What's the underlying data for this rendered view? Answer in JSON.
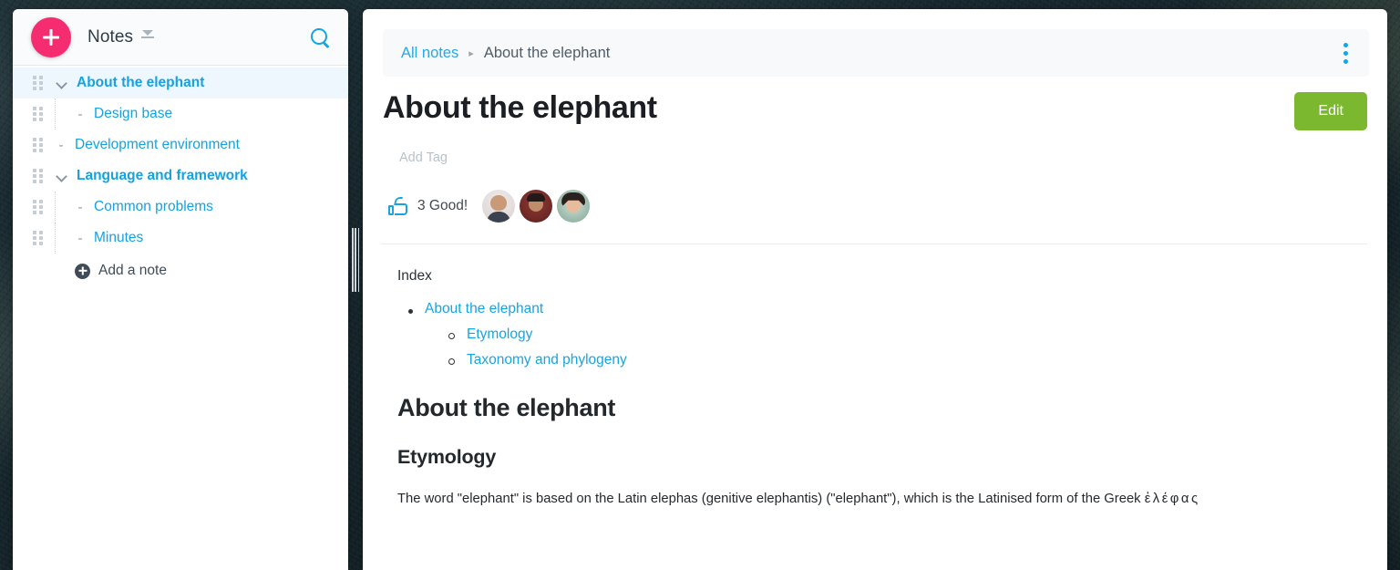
{
  "sidebar": {
    "add_button_icon": "plus-icon",
    "title": "Notes",
    "collapse_icon": "collapse-icon",
    "search_icon": "search-icon",
    "tree": [
      {
        "label": "About the elephant",
        "level": 0,
        "marker": "chevron-down-icon",
        "selected": true,
        "bold": true
      },
      {
        "label": "Design base",
        "level": 1,
        "marker": "dash",
        "selected": false,
        "bold": false
      },
      {
        "label": "Development environment",
        "level": 0,
        "marker": "dash",
        "selected": false,
        "bold": false
      },
      {
        "label": "Language and framework",
        "level": 0,
        "marker": "chevron-down-icon",
        "selected": false,
        "bold": true
      },
      {
        "label": "Common problems",
        "level": 1,
        "marker": "dash",
        "selected": false,
        "bold": false
      },
      {
        "label": "Minutes",
        "level": 1,
        "marker": "dash",
        "selected": false,
        "bold": false
      }
    ],
    "add_note_label": "Add a note"
  },
  "content": {
    "breadcrumb": {
      "home": "All notes",
      "separator": "▸",
      "current": "About the elephant"
    },
    "menu_icon": "kebab-menu-icon",
    "title": "About the elephant",
    "edit_label": "Edit",
    "tag_placeholder": "Add Tag",
    "reaction": {
      "icon": "thumbs-up-icon",
      "count_label": "3 Good!",
      "avatars": [
        "avatar-1",
        "avatar-2",
        "avatar-3"
      ]
    },
    "index_heading": "Index",
    "index": [
      {
        "label": "About the elephant",
        "children": [
          "Etymology",
          "Taxonomy and phylogeny"
        ]
      }
    ],
    "h1": "About the elephant",
    "h2": "Etymology",
    "paragraph_prefix": "The word \"elephant\" is based on the Latin elephas (genitive elephantis) (\"elephant\"), which is the Latinised form of the Greek ",
    "paragraph_greek": "ἐλέφας"
  },
  "colors": {
    "accent_pink": "#f52d70",
    "link_blue": "#14a3e0",
    "edit_green": "#7cb82f",
    "selected_row": "#eef7fd",
    "text_dark": "#23282d"
  }
}
